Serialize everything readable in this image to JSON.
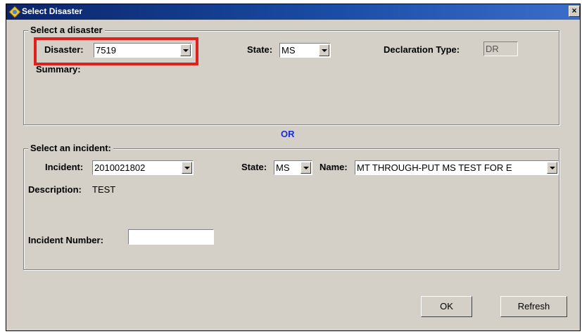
{
  "window": {
    "title": "Select Disaster",
    "close_label": "×"
  },
  "disaster_group": {
    "legend": "Select a disaster",
    "disaster_label": "Disaster:",
    "disaster_value": "7519",
    "state_label": "State:",
    "state_value": "MS",
    "declaration_label": "Declaration Type:",
    "declaration_value": "DR",
    "summary_label": "Summary:"
  },
  "or_text": "OR",
  "incident_group": {
    "legend": "Select an incident:",
    "incident_label": "Incident:",
    "incident_value": "2010021802",
    "state_label": "State:",
    "state_value": "MS",
    "name_label": "Name:",
    "name_value": "MT THROUGH-PUT MS TEST FOR E",
    "description_label": "Description:",
    "description_value": "TEST",
    "incident_number_label": "Incident  Number:",
    "incident_number_value": ""
  },
  "buttons": {
    "ok": "OK",
    "refresh": "Refresh"
  },
  "colors": {
    "highlight": "#e0201c",
    "title_bar": "#0a246a",
    "or_text": "#1a2bd6"
  }
}
